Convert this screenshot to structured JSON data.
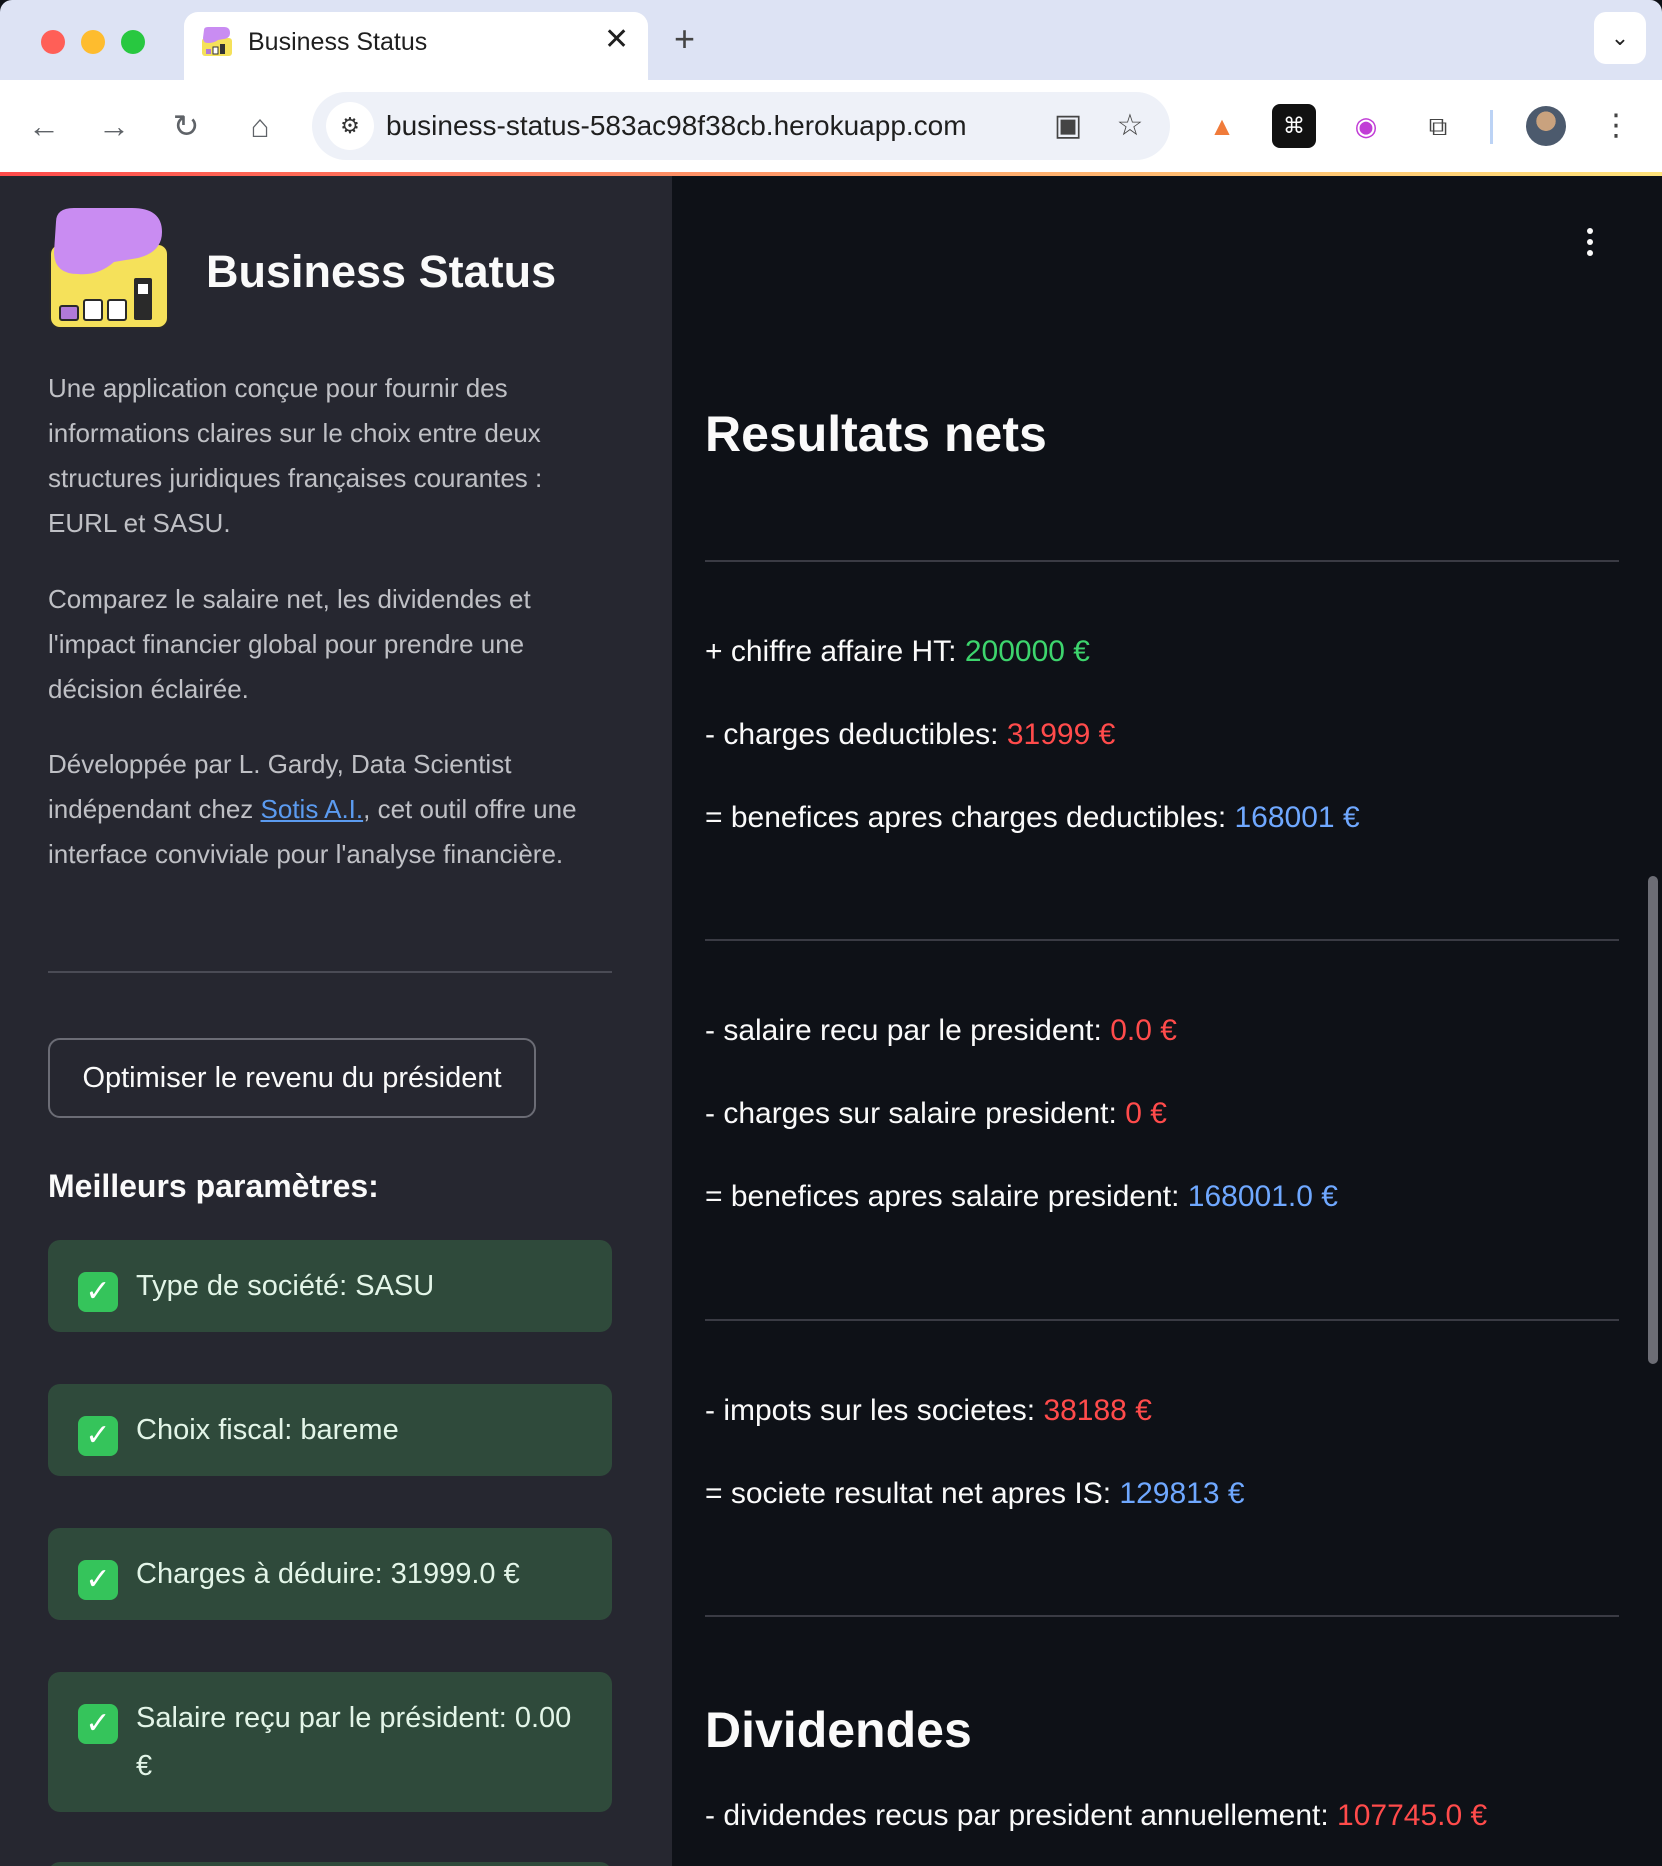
{
  "browser": {
    "tab_title": "Business Status",
    "url": "business-status-583ac98f38cb.herokuapp.com"
  },
  "sidebar": {
    "app_title": "Business Status",
    "paragraphs": [
      "Une application conçue pour fournir des informations claires sur le choix entre deux structures juridiques françaises courantes : EURL et SASU.",
      "Comparez le salaire net, les dividendes et l'impact financier global pour prendre une décision éclairée."
    ],
    "dev_prefix": "Développée par L. Gardy, Data Scientist indépendant chez ",
    "dev_link": "Sotis A.I.",
    "dev_suffix": ", cet outil offre une interface conviviale pour l'analyse financière.",
    "optimize_button": "Optimiser le revenu du président",
    "best_params_heading": "Meilleurs paramètres:",
    "best_params": [
      "Type de société: SASU",
      "Choix fiscal: bareme",
      "Charges à déduire: 31999.0 €",
      "Salaire reçu par le président: 0.00 €"
    ]
  },
  "main": {
    "results_heading": "Resultats nets",
    "lines": [
      {
        "label": "+ chiffre affaire HT: ",
        "value": "200000 €",
        "color": "#3dd56d"
      },
      {
        "label": "- charges deductibles: ",
        "value": "31999 €",
        "color": "#ff4b4b"
      },
      {
        "label": "= benefices apres charges deductibles: ",
        "value": "168001 €",
        "color": "#6fa8ff"
      },
      {
        "label": "- salaire recu par le president: ",
        "value": "0.0 €",
        "color": "#ff4b4b"
      },
      {
        "label": "- charges sur salaire president: ",
        "value": "0 €",
        "color": "#ff4b4b"
      },
      {
        "label": "= benefices apres salaire president: ",
        "value": "168001.0 €",
        "color": "#6fa8ff"
      },
      {
        "label": "- impots sur les societes: ",
        "value": "38188 €",
        "color": "#ff4b4b"
      },
      {
        "label": "= societe resultat net apres IS: ",
        "value": "129813 €",
        "color": "#6fa8ff"
      }
    ],
    "dividends_heading": "Dividendes",
    "dividend_line": {
      "label": "- dividendes recus par president annuellement: ",
      "value": "107745.0 €",
      "color": "#ff4b4b"
    }
  }
}
